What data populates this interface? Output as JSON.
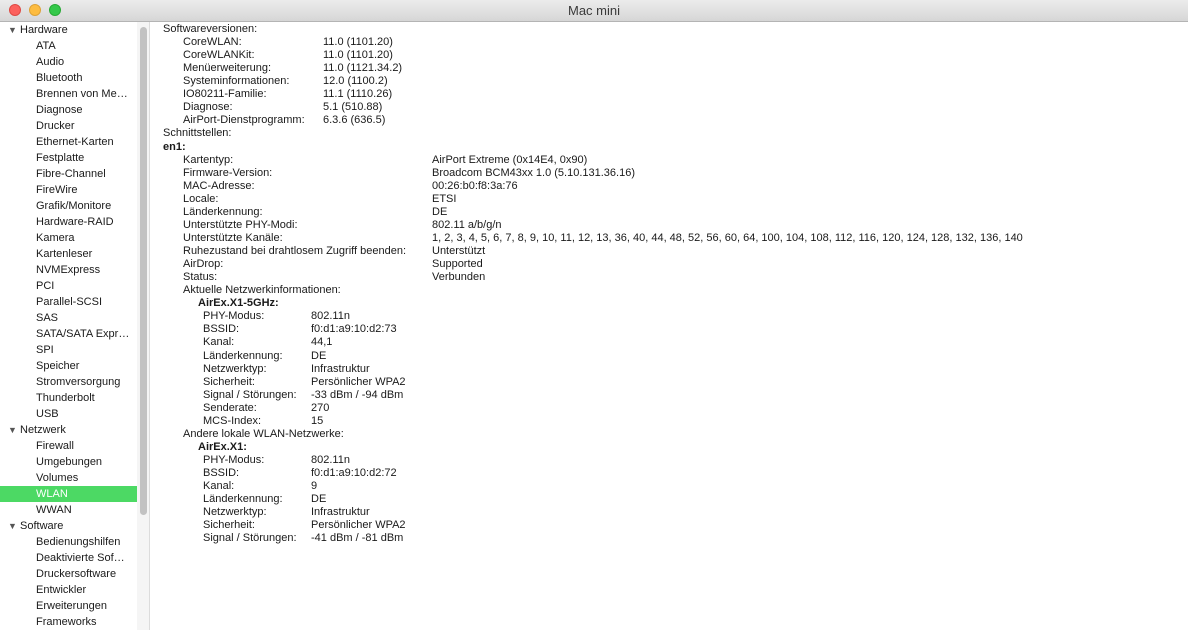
{
  "window": {
    "title": "Mac mini"
  },
  "sidebar": {
    "categories": [
      {
        "label": "Hardware",
        "items": [
          "ATA",
          "Audio",
          "Bluetooth",
          "Brennen von Me…",
          "Diagnose",
          "Drucker",
          "Ethernet-Karten",
          "Festplatte",
          "Fibre-Channel",
          "FireWire",
          "Grafik/Monitore",
          "Hardware-RAID",
          "Kamera",
          "Kartenleser",
          "NVMExpress",
          "PCI",
          "Parallel-SCSI",
          "SAS",
          "SATA/SATA Expr…",
          "SPI",
          "Speicher",
          "Stromversorgung",
          "Thunderbolt",
          "USB"
        ]
      },
      {
        "label": "Netzwerk",
        "items": [
          "Firewall",
          "Umgebungen",
          "Volumes",
          "WLAN",
          "WWAN"
        ]
      },
      {
        "label": "Software",
        "items": [
          "Bedienungshilfen",
          "Deaktivierte Sof…",
          "Druckersoftware",
          "Entwickler",
          "Erweiterungen",
          "Frameworks"
        ]
      }
    ],
    "selected": "WLAN"
  },
  "content": {
    "lines": [
      {
        "label": "Softwareversionen:",
        "value": "",
        "indent": 0
      },
      {
        "label": "CoreWLAN:",
        "value": "11.0 (1101.20)",
        "indent": 1
      },
      {
        "label": "CoreWLANKit:",
        "value": "11.0 (1101.20)",
        "indent": 1
      },
      {
        "label": "Menüerweiterung:",
        "value": "11.0 (1121.34.2)",
        "indent": 1
      },
      {
        "label": "Systeminformationen:",
        "value": "12.0 (1100.2)",
        "indent": 1
      },
      {
        "label": "IO80211-Familie:",
        "value": "11.1 (1110.26)",
        "indent": 1
      },
      {
        "label": "Diagnose:",
        "value": "5.1 (510.88)",
        "indent": 1
      },
      {
        "label": "AirPort-Dienstprogramm:",
        "value": "6.3.6 (636.5)",
        "indent": 1
      },
      {
        "label": "Schnittstellen:",
        "value": "",
        "indent": 0
      },
      {
        "label": "en1:",
        "value": "",
        "indent": 0,
        "bold": true
      },
      {
        "label": "Kartentyp:",
        "value": "AirPort Extreme  (0x14E4, 0x90)",
        "indent": 2
      },
      {
        "label": "Firmware-Version:",
        "value": "Broadcom BCM43xx 1.0 (5.10.131.36.16)",
        "indent": 2
      },
      {
        "label": "MAC-Adresse:",
        "value": "00:26:b0:f8:3a:76",
        "indent": 2
      },
      {
        "label": "Locale:",
        "value": "ETSI",
        "indent": 2
      },
      {
        "label": "Länderkennung:",
        "value": "DE",
        "indent": 2
      },
      {
        "label": "Unterstützte PHY-Modi:",
        "value": "802.11 a/b/g/n",
        "indent": 2
      },
      {
        "label": "Unterstützte Kanäle:",
        "value": "1, 2, 3, 4, 5, 6, 7, 8, 9, 10, 11, 12, 13, 36, 40, 44, 48, 52, 56, 60, 64, 100, 104, 108, 112, 116, 120, 124, 128, 132, 136, 140",
        "indent": 2
      },
      {
        "label": "Ruhezustand bei drahtlosem Zugriff beenden:",
        "value": "Unterstützt",
        "indent": 2
      },
      {
        "label": "AirDrop:",
        "value": "Supported",
        "indent": 2
      },
      {
        "label": "Status:",
        "value": "Verbunden",
        "indent": 2
      },
      {
        "label": "Aktuelle Netzwerkinformationen:",
        "value": "",
        "indent": 2
      },
      {
        "label": "AirEx.X1-5GHz:",
        "value": "",
        "indent": 3,
        "bold": true
      },
      {
        "label": "PHY-Modus:",
        "value": "802.11n",
        "indent": 4
      },
      {
        "label": "BSSID:",
        "value": "f0:d1:a9:10:d2:73",
        "indent": 4
      },
      {
        "label": "Kanal:",
        "value": "44,1",
        "indent": 4
      },
      {
        "label": "Länderkennung:",
        "value": "DE",
        "indent": 4
      },
      {
        "label": "Netzwerktyp:",
        "value": "Infrastruktur",
        "indent": 4
      },
      {
        "label": "Sicherheit:",
        "value": "Persönlicher WPA2",
        "indent": 4
      },
      {
        "label": "Signal / Störungen:",
        "value": "-33 dBm / -94 dBm",
        "indent": 4
      },
      {
        "label": "Senderate:",
        "value": "270",
        "indent": 4
      },
      {
        "label": "MCS-Index:",
        "value": "15",
        "indent": 4
      },
      {
        "label": "Andere lokale WLAN-Netzwerke:",
        "value": "",
        "indent": 2
      },
      {
        "label": "AirEx.X1:",
        "value": "",
        "indent": 3,
        "bold": true
      },
      {
        "label": "PHY-Modus:",
        "value": "802.11n",
        "indent": 4
      },
      {
        "label": "BSSID:",
        "value": "f0:d1:a9:10:d2:72",
        "indent": 4
      },
      {
        "label": "Kanal:",
        "value": "9",
        "indent": 4
      },
      {
        "label": "Länderkennung:",
        "value": "DE",
        "indent": 4
      },
      {
        "label": "Netzwerktyp:",
        "value": "Infrastruktur",
        "indent": 4
      },
      {
        "label": "Sicherheit:",
        "value": "Persönlicher WPA2",
        "indent": 4
      },
      {
        "label": "Signal / Störungen:",
        "value": "-41 dBm / -81 dBm",
        "indent": 4
      }
    ]
  },
  "colors": {
    "selection": "#4cd964",
    "close": "#fc615d",
    "minimize": "#fdbc40",
    "maximize": "#34c84a"
  }
}
